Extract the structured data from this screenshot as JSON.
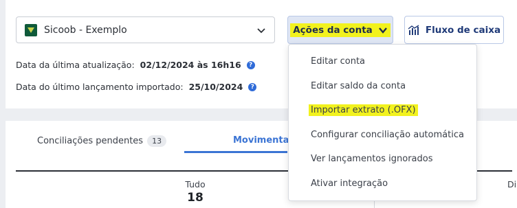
{
  "account": {
    "name": "Sicoob - Exemplo",
    "logo_color": "#0f5a3a"
  },
  "toolbar": {
    "actions_label": "Ações da conta",
    "flow_label": "Fluxo de caixa"
  },
  "info": {
    "last_update_label": "Data da última atualização:",
    "last_update_value": "02/12/2024 às 16h16",
    "last_import_label": "Data do último lançamento importado:",
    "last_import_value": "25/10/2024"
  },
  "tabs": {
    "pending_label": "Conciliações pendentes",
    "pending_count": "13",
    "movements_label": "Movimentações"
  },
  "summary": {
    "all_label": "Tudo",
    "all_value": "18",
    "right_label": "Di"
  },
  "menu": {
    "items": [
      {
        "label": "Editar conta"
      },
      {
        "label": "Editar saldo da conta"
      },
      {
        "label": "Importar extrato (.OFX)"
      },
      {
        "label": "Configurar conciliação automática"
      },
      {
        "label": "Ver lançamentos ignorados"
      },
      {
        "label": "Ativar integração"
      }
    ]
  },
  "colors": {
    "highlight": "#f2f21e",
    "accent": "#3b74d4",
    "help": "#2f6bd8"
  }
}
